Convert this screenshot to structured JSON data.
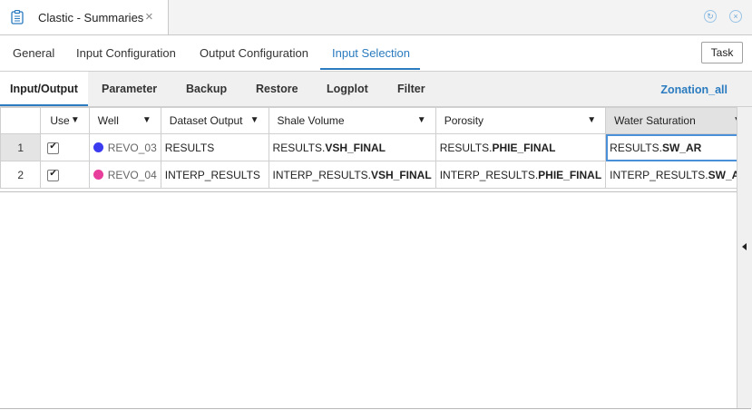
{
  "window": {
    "title": "Clastic - Summaries",
    "close_glyph": "×",
    "refresh_glyph": "↻",
    "win_close_glyph": "×"
  },
  "nav": {
    "tabs": [
      "General",
      "Input Configuration",
      "Output Configuration",
      "Input Selection"
    ],
    "active": "Input Selection",
    "task_label": "Task"
  },
  "subnav": {
    "tabs": [
      "Input/Output",
      "Parameter",
      "Backup",
      "Restore",
      "Logplot",
      "Filter"
    ],
    "active": "Input/Output",
    "zonation_label": "Zonation_all"
  },
  "table": {
    "columns": [
      "Use",
      "Well",
      "Dataset Output",
      "Shale Volume",
      "Porosity",
      "Water Saturation"
    ],
    "rows": [
      {
        "num": "1",
        "use": true,
        "well": "REVO_03",
        "well_color": "#3b3bf0",
        "dataset": "RESULTS",
        "shale_prefix": "RESULTS.",
        "shale_bold": "VSH_FINAL",
        "poro_prefix": "RESULTS.",
        "poro_bold": "PHIE_FINAL",
        "sw_prefix": "RESULTS.",
        "sw_bold": "SW_AR"
      },
      {
        "num": "2",
        "use": true,
        "well": "REVO_04",
        "well_color": "#e83e9c",
        "dataset": "INTERP_RESULTS",
        "shale_prefix": "INTERP_RESULTS.",
        "shale_bold": "VSH_FINAL",
        "poro_prefix": "INTERP_RESULTS.",
        "poro_bold": "PHIE_FINAL",
        "sw_prefix": "INTERP_RESULTS.",
        "sw_bold": "SW_AR"
      }
    ]
  },
  "colors": {
    "accent": "#2a7bbf"
  }
}
